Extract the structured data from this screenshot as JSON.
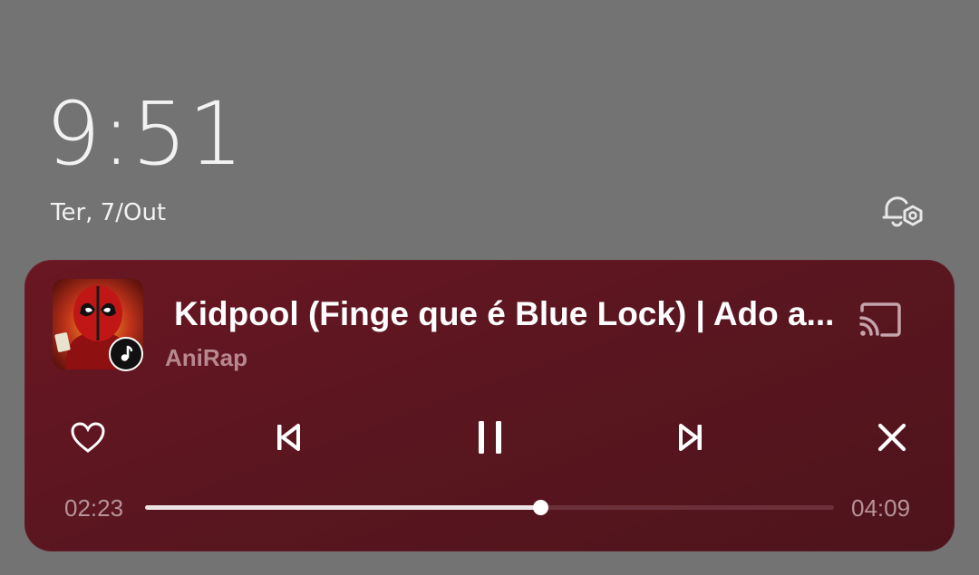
{
  "lockscreen": {
    "time": "9:51",
    "date": "Ter, 7/Out",
    "icons": {
      "notification_settings": "bell-gear-icon"
    }
  },
  "player": {
    "title": "Kidpool (Finge que é Blue Lock) | Ado a...",
    "artist": "AniRap",
    "elapsed": "02:23",
    "duration": "04:09",
    "progress": 0.574,
    "colors": {
      "background": "#5b1620",
      "accent": "#ffffff",
      "muted": "#b88890"
    },
    "icons": {
      "album_art": "deadpool-art",
      "app_badge": "music-note-icon",
      "cast": "cast-icon",
      "like": "heart-outline-icon",
      "previous": "skip-previous-icon",
      "play_pause": "pause-icon",
      "next": "skip-next-icon",
      "close": "close-icon"
    }
  }
}
